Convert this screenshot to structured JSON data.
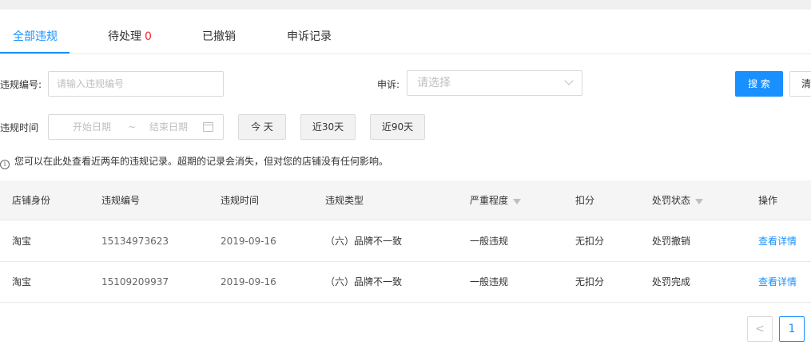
{
  "tabs": [
    {
      "label": "全部违规"
    },
    {
      "label": "待处理",
      "count": "0"
    },
    {
      "label": "已撤销"
    },
    {
      "label": "申诉记录"
    }
  ],
  "filters": {
    "violation_id_label": "违规编号:",
    "violation_id_placeholder": "请输入违规编号",
    "appeal_label": "申诉:",
    "appeal_placeholder": "请选择",
    "search_button": "搜 索",
    "clear_button": "清",
    "time_label": "违规时间",
    "start_date_placeholder": "开始日期",
    "range_separator": "~",
    "end_date_placeholder": "结束日期",
    "quick_today": "今 天",
    "quick_30": "近30天",
    "quick_90": "近90天"
  },
  "notice": "您可以在此处查看近两年的违规记录。超期的记录会消失，但对您的店铺没有任何影响。",
  "table": {
    "headers": [
      "店铺身份",
      "违规编号",
      "违规时间",
      "违规类型",
      "严重程度",
      "扣分",
      "处罚状态",
      "操作"
    ],
    "rows": [
      {
        "shop": "淘宝",
        "id": "15134973623",
        "time": "2019-09-16",
        "type": "（六）品牌不一致",
        "severity": "一般违规",
        "points": "无扣分",
        "status": "处罚撤销",
        "action": "查看详情"
      },
      {
        "shop": "淘宝",
        "id": "15109209937",
        "time": "2019-09-16",
        "type": "（六）品牌不一致",
        "severity": "一般违规",
        "points": "无扣分",
        "status": "处罚完成",
        "action": "查看详情"
      }
    ]
  },
  "pagination": {
    "prev": "<",
    "current": "1"
  },
  "icons": {
    "info": "info-icon",
    "calendar": "calendar-icon",
    "filter": "filter-icon",
    "chevron": "chevron-down-icon"
  },
  "colors": {
    "accent": "#1890ff",
    "count": "#f5222d"
  }
}
